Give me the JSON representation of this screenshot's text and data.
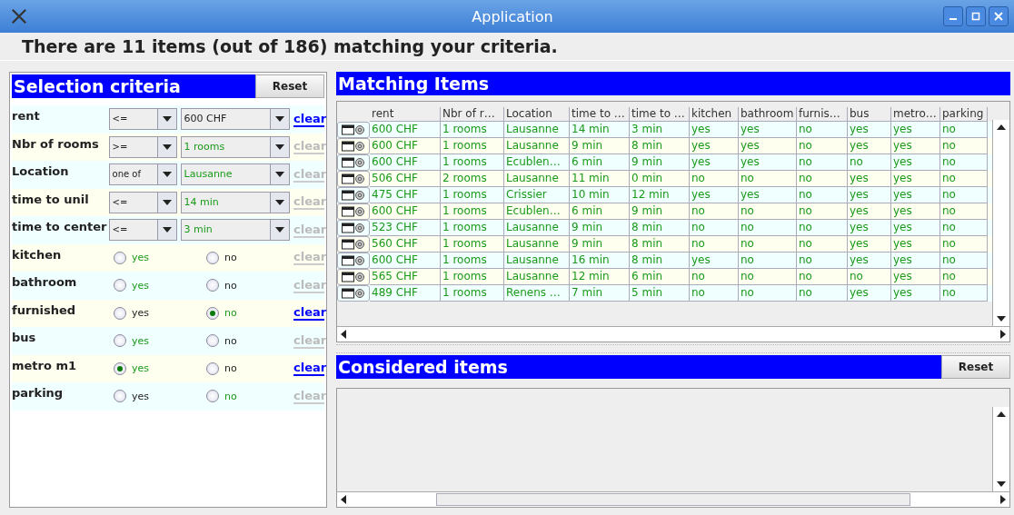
{
  "window": {
    "title": "Application"
  },
  "summary": "There are 11 items (out of 186) matching your criteria.",
  "criteria": {
    "title": "Selection criteria",
    "reset": "Reset",
    "rows": [
      {
        "kind": "combo",
        "label": "rent",
        "operator": "<=",
        "value": "600 CHF",
        "highlight": false,
        "clear_enabled": true,
        "clear": "clear"
      },
      {
        "kind": "combo",
        "label": "Nbr of rooms",
        "operator": ">=",
        "value": "1 rooms",
        "highlight": true,
        "clear_enabled": false,
        "clear": "clear"
      },
      {
        "kind": "combo",
        "label": "Location",
        "operator": "one of",
        "value": "Lausanne",
        "highlight": true,
        "clear_enabled": false,
        "clear": "clear"
      },
      {
        "kind": "combo",
        "label": "time to unil",
        "operator": "<=",
        "value": "14 min",
        "highlight": true,
        "clear_enabled": false,
        "clear": "clear"
      },
      {
        "kind": "combo",
        "label": "time to center",
        "operator": "<=",
        "value": "3 min",
        "highlight": true,
        "clear_enabled": false,
        "clear": "clear"
      },
      {
        "kind": "radio",
        "label": "kitchen",
        "options": [
          {
            "label": "yes",
            "selected": false,
            "highlight": true
          },
          {
            "label": "no",
            "selected": false,
            "highlight": false
          }
        ],
        "clear_enabled": false,
        "clear": "clear"
      },
      {
        "kind": "radio",
        "label": "bathroom",
        "options": [
          {
            "label": "yes",
            "selected": false,
            "highlight": true
          },
          {
            "label": "no",
            "selected": false,
            "highlight": false
          }
        ],
        "clear_enabled": false,
        "clear": "clear"
      },
      {
        "kind": "radio",
        "label": "furnished",
        "options": [
          {
            "label": "yes",
            "selected": false,
            "highlight": false
          },
          {
            "label": "no",
            "selected": true,
            "highlight": true
          }
        ],
        "clear_enabled": true,
        "clear": "clear"
      },
      {
        "kind": "radio",
        "label": "bus",
        "options": [
          {
            "label": "yes",
            "selected": false,
            "highlight": true
          },
          {
            "label": "no",
            "selected": false,
            "highlight": false
          }
        ],
        "clear_enabled": false,
        "clear": "clear"
      },
      {
        "kind": "radio",
        "label": "metro m1",
        "options": [
          {
            "label": "yes",
            "selected": true,
            "highlight": true
          },
          {
            "label": "no",
            "selected": false,
            "highlight": false
          }
        ],
        "clear_enabled": true,
        "clear": "clear"
      },
      {
        "kind": "radio",
        "label": "parking",
        "options": [
          {
            "label": "yes",
            "selected": false,
            "highlight": false
          },
          {
            "label": "no",
            "selected": false,
            "highlight": true
          }
        ],
        "clear_enabled": false,
        "clear": "clear"
      }
    ]
  },
  "matching": {
    "title": "Matching Items",
    "columns": [
      "rent",
      "Nbr of r…",
      "Location",
      "time to …",
      "time to …",
      "kitchen",
      "bathroom",
      "furnis…",
      "bus",
      "metro…",
      "parking"
    ],
    "rows": [
      [
        "600 CHF",
        "1 rooms",
        "Lausanne",
        "14 min",
        "3 min",
        "yes",
        "yes",
        "no",
        "yes",
        "yes",
        "no"
      ],
      [
        "600 CHF",
        "1 rooms",
        "Lausanne",
        "9 min",
        "8 min",
        "yes",
        "yes",
        "no",
        "yes",
        "yes",
        "no"
      ],
      [
        "600 CHF",
        "1 rooms",
        "Ecublen…",
        "6 min",
        "9 min",
        "yes",
        "yes",
        "no",
        "no",
        "yes",
        "no"
      ],
      [
        "506 CHF",
        "2 rooms",
        "Lausanne",
        "11 min",
        "0 min",
        "no",
        "no",
        "no",
        "yes",
        "yes",
        "no"
      ],
      [
        "475 CHF",
        "1 rooms",
        "Crissier",
        "10 min",
        "12 min",
        "yes",
        "yes",
        "no",
        "yes",
        "yes",
        "no"
      ],
      [
        "600 CHF",
        "1 rooms",
        "Ecublen…",
        "6 min",
        "9 min",
        "no",
        "no",
        "no",
        "yes",
        "yes",
        "no"
      ],
      [
        "523 CHF",
        "1 rooms",
        "Lausanne",
        "9 min",
        "8 min",
        "no",
        "no",
        "no",
        "yes",
        "yes",
        "no"
      ],
      [
        "560 CHF",
        "1 rooms",
        "Lausanne",
        "9 min",
        "8 min",
        "no",
        "no",
        "no",
        "yes",
        "yes",
        "no"
      ],
      [
        "600 CHF",
        "1 rooms",
        "Lausanne",
        "16 min",
        "8 min",
        "yes",
        "no",
        "no",
        "yes",
        "yes",
        "no"
      ],
      [
        "565 CHF",
        "1 rooms",
        "Lausanne",
        "12 min",
        "6 min",
        "no",
        "no",
        "no",
        "no",
        "yes",
        "no"
      ],
      [
        "489 CHF",
        "1 rooms",
        "Renens …",
        "7 min",
        "5 min",
        "no",
        "no",
        "no",
        "yes",
        "yes",
        "no"
      ]
    ]
  },
  "considered": {
    "title": "Considered items",
    "reset": "Reset"
  }
}
